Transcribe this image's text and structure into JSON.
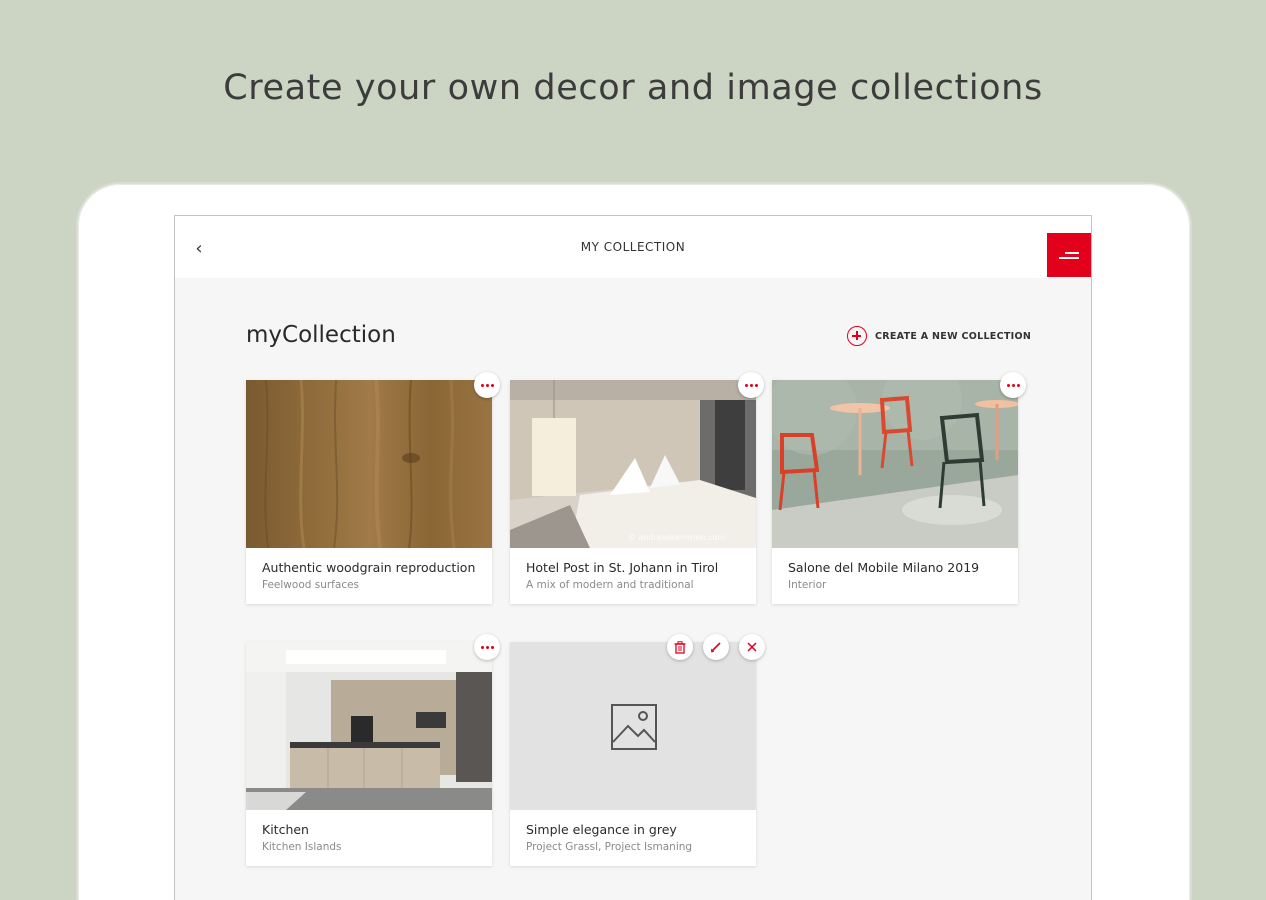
{
  "headline": "Create your own decor and image collections",
  "topbar": {
    "back_icon": "back-chevron-icon",
    "title": "MY COLLECTION",
    "menu_icon": "menu-icon"
  },
  "main": {
    "page_title": "myCollection",
    "create_button_label": "CREATE A NEW COLLECTION"
  },
  "colors": {
    "accent": "#e2001a",
    "background": "#ccd4c3",
    "screen_bg": "#f6f6f6"
  },
  "collections": [
    {
      "title": "Authentic woodgrain reproduction",
      "subtitle": "Feelwood surfaces",
      "image": "woodgrain texture"
    },
    {
      "title": "Hotel Post in St. Johann in Tirol",
      "subtitle": "A mix of modern and traditional",
      "image": "hotel room with bed",
      "watermark": "© andreaskemmen.com"
    },
    {
      "title": "Salone del Mobile Milano 2019",
      "subtitle": "Interior",
      "image": "red and green chairs with tables"
    },
    {
      "title": "Kitchen",
      "subtitle": "Kitchen Islands",
      "image": "modern kitchen island"
    },
    {
      "title": "Simple elegance in grey",
      "subtitle": "Project Grassl, Project Ismaning",
      "image": "placeholder-image-icon"
    }
  ]
}
